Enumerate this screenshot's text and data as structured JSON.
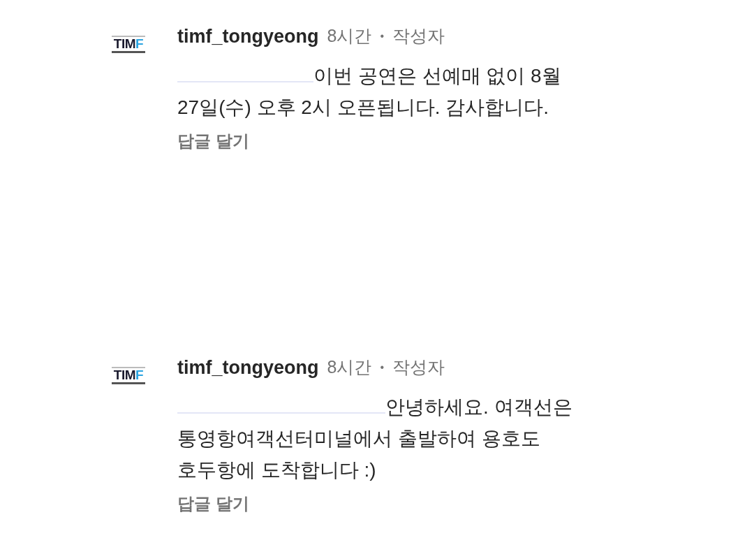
{
  "comments": [
    {
      "logo": {
        "text": "TIM",
        "accent": "F"
      },
      "username": "timf_tongyeong",
      "time": "8시간",
      "separator": "•",
      "badge": "작성자",
      "mention_hidden": true,
      "text": "이번 공연은 선예매 없이 8월\n27일(수) 오후 2시 오픈됩니다. 감사합니다.",
      "reply": "답글 달기"
    },
    {
      "logo": {
        "text": "TIM",
        "accent": "F"
      },
      "username": "timf_tongyeong",
      "time": "8시간",
      "separator": "•",
      "badge": "작성자",
      "mention_hidden": true,
      "text": "안녕하세요. 여객선은\n통영항여객선터미널에서 출발하여 용호도\n호두항에 도착합니다 :)",
      "reply": "답글 달기"
    }
  ]
}
